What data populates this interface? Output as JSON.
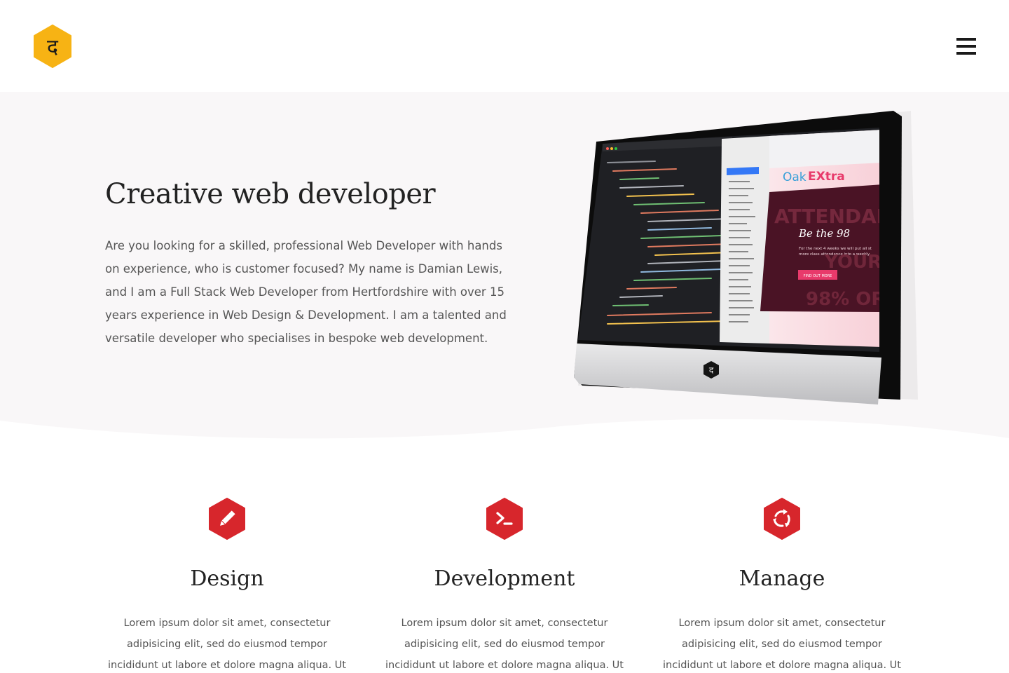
{
  "brand": {
    "logo_glyph": "द",
    "logo_icon": "hexagon-logo-icon",
    "logo_color": "#f7b314"
  },
  "nav": {
    "menu_icon": "hamburger-menu-icon"
  },
  "hero": {
    "title": "Creative web developer",
    "text": "Are you looking for a skilled, professional Web Developer with hands on experience, who is customer focused? My name is Damian Lewis, and I am a Full Stack Web Developer from Hertfordshire with over 15 years experience in Web Design & Development. I am a talented and versatile developer who specialises in bespoke web development.",
    "screen": {
      "site_brand_oak": "Oak",
      "site_brand_extra": "EXtra",
      "banner_text_1": "ATTENDANC",
      "banner_heading": "Be the 98",
      "banner_sub_1": "For the next 4 weeks we will put all st",
      "banner_sub_2": "more class attendance into a weekly",
      "banner_button": "FIND OUT MORE",
      "banner_text_2": "YOUR C",
      "banner_text_3": "98% OR M",
      "monitor_badge": "द"
    }
  },
  "services": [
    {
      "icon": "pencil-icon",
      "title": "Design",
      "text": "Lorem ipsum dolor sit amet, consectetur adipisicing elit, sed do eiusmod tempor incididunt ut labore et dolore magna aliqua. Ut enim ad"
    },
    {
      "icon": "terminal-icon",
      "title": "Development",
      "text": "Lorem ipsum dolor sit amet, consectetur adipisicing elit, sed do eiusmod tempor incididunt ut labore et dolore magna aliqua. Ut enim ad"
    },
    {
      "icon": "refresh-cycle-icon",
      "title": "Manage",
      "text": "Lorem ipsum dolor sit amet, consectetur adipisicing elit, sed do eiusmod tempor incididunt ut labore et dolore magna aliqua. Ut enim ad"
    }
  ],
  "colors": {
    "accent": "#f7b314",
    "service_icon": "#d7262c",
    "hero_bg": "#f9f7f8"
  }
}
